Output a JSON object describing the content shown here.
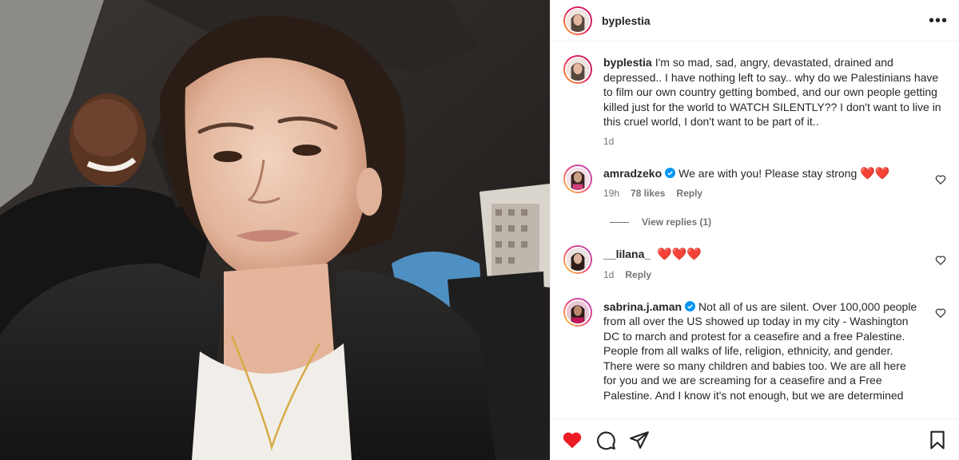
{
  "post": {
    "author": "byplestia",
    "more_icon": "more-horizontal-icon"
  },
  "caption": {
    "username": "byplestia",
    "text": "I'm so mad, sad, angry, devastated, drained and depressed.. I have nothing left to say.. why do we Palestinians have to film our own country getting bombed, and our own people getting killed just for the world to WATCH SILENTLY?? I don't want to live in this cruel world, I don't want to be part of it..",
    "time": "1d"
  },
  "comments": [
    {
      "username": "amradzeko",
      "verified": true,
      "text": "We are with you! Please stay strong",
      "emoji": "❤️❤️",
      "time": "19h",
      "likes": "78 likes",
      "reply": "Reply",
      "view_replies": "View replies (1)"
    },
    {
      "username": "__lilana_",
      "verified": false,
      "text": "",
      "emoji": "❤️❤️❤️",
      "time": "1d",
      "reply": "Reply"
    },
    {
      "username": "sabrina.j.aman",
      "verified": true,
      "text": "Not all of us are silent. Over 100,000 people from all over the US showed up today in my city - Washington DC to march and protest for a ceasefire and a free Palestine. People from all walks of life, religion, ethnicity, and gender. There were so many children and babies too. We are all here for you and we are screaming for a ceasefire and a Free Palestine. And I know it's not enough, but we are determined"
    }
  ],
  "actions": {
    "like_color": "#ed1c24"
  },
  "colors": {
    "accent_like": "#ed1c24",
    "verified": "#0095f6",
    "muted": "#737373"
  }
}
